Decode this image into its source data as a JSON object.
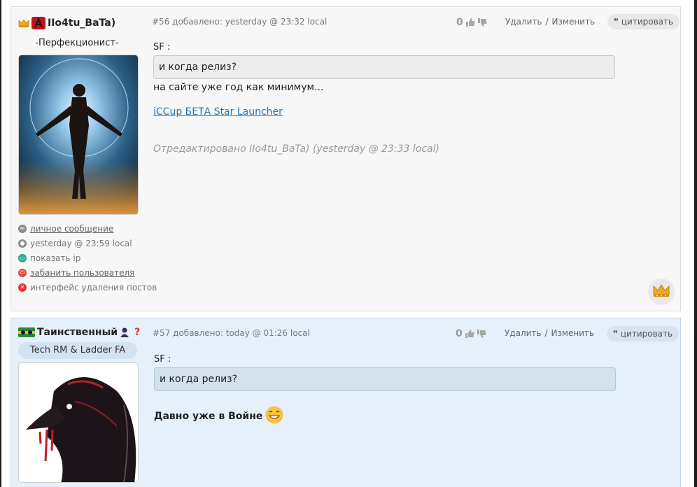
{
  "posts": [
    {
      "username": "IIo4tu_BaTa)",
      "status_text": "-Перфекционист-",
      "post_number": "#56",
      "posted_meta": "добавлено: yesterday @ 23:32 local",
      "rating": "0",
      "delete_label": "Удалить",
      "edit_label": "Изменить",
      "separator": "/",
      "cite_label": "цитировать",
      "quote_author": "SF :",
      "quote_text": "и когда релиз?",
      "body_text": "на сайте уже год как минимум...",
      "link_text": "iCCup БЕТА Star Launcher",
      "edited_text": "Отредактировано IIo4tu_BaTa) (yesterday @ 23:33 local)",
      "info": {
        "private_message": "личное сообщение",
        "last_seen": "yesterday @ 23:59 local",
        "show_ip": "показать ip",
        "ban_user": "забанить пользователя",
        "delete_posts": "интерфейс удаления постов"
      }
    },
    {
      "username": "Таинственный",
      "badge": "Tech RM & Ladder FA",
      "post_number": "#57",
      "posted_meta": "добавлено: today @ 01:26 local",
      "rating": "0",
      "delete_label": "Удалить",
      "edit_label": "Изменить",
      "separator": "/",
      "cite_label": "цитировать",
      "quote_author": "SF :",
      "quote_text": "и когда релиз?",
      "body_text": "Давно уже в Войне",
      "question_mark": "?"
    }
  ],
  "colors": {
    "link": "#2d74b8",
    "post_even_bg": "#f7f7f7",
    "post_odd_bg": "#e5f0fa"
  }
}
